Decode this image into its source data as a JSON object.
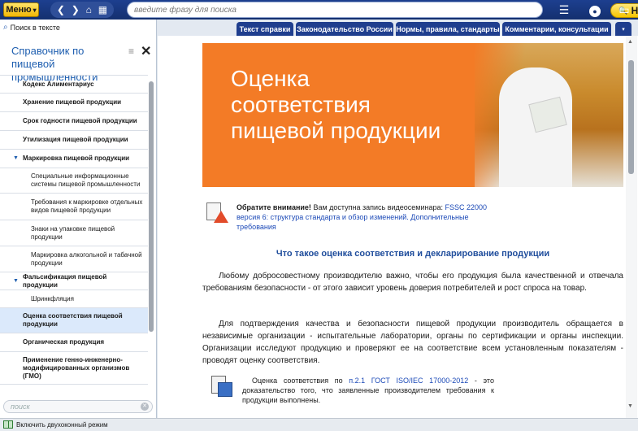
{
  "topbar": {
    "menu_label": "Меню",
    "menu_caret": "▾",
    "nav_back": "❮",
    "nav_forward": "❯",
    "nav_home": "⌂",
    "nav_grid": "▦",
    "search_placeholder": "введите фразу для поиска",
    "find_label": "Найти",
    "find_icon": "🔍",
    "hamburger_icon": "☰",
    "user_icon": "●",
    "chat_icon": "▭"
  },
  "sidebar": {
    "search_in_text": "Поиск в тексте",
    "title": "Справочник по пищевой промышленности",
    "menu_icon": "≡",
    "close_icon": "✕",
    "filter_placeholder": "поиск",
    "items": [
      {
        "label": "Кодекс Алиментариус",
        "level": 0,
        "h": 22
      },
      {
        "label": "Хранение пищевой продукции",
        "level": 0,
        "h": 23
      },
      {
        "label": "Срок годности пищевой продукции",
        "level": 0,
        "h": 23
      },
      {
        "label": "Утилизация пищевой продукции",
        "level": 0,
        "h": 23
      },
      {
        "label": "Маркировка пищевой продукции",
        "level": 0,
        "h": 23,
        "expanded": true
      },
      {
        "label": "Специальные информационные системы пищевой промышленности",
        "level": 1,
        "h": 31
      },
      {
        "label": "Требования к маркировке отдельных видов пищевой продукции",
        "level": 1,
        "h": 33
      },
      {
        "label": "Знаки на упаковке пищевой продукции",
        "level": 1,
        "h": 32
      },
      {
        "label": "Маркировка алкогольной и табачной продукции",
        "level": 1,
        "h": 32
      },
      {
        "label": "Фальсификация пищевой продукции",
        "level": 0,
        "h": 22,
        "expanded": true
      },
      {
        "label": "Шринкфляция",
        "level": 1,
        "h": 22
      },
      {
        "label": "Оценка соответствия пищевой продукции",
        "level": 0,
        "h": 31,
        "active": true
      },
      {
        "label": "Органическая продукция",
        "level": 0,
        "h": 23
      },
      {
        "label": "Применение генно-инженерно-модифицированных организмов (ГМО)",
        "level": 0,
        "h": 40
      }
    ]
  },
  "tabs": [
    {
      "label": "Текст справки",
      "active": true
    },
    {
      "label": "Законодательство России",
      "active": false
    },
    {
      "label": "Нормы, правила, стандарты",
      "active": false
    },
    {
      "label": "Комментарии, консультации",
      "active": false
    }
  ],
  "tab_more_icon": "▾",
  "document": {
    "banner_title": "Оценка соответствия пищевой продукции",
    "notice_bold": "Обратите внимание!",
    "notice_text": "Вам доступна запись видеосеминара:",
    "notice_link": "FSSC 22000 версия 6: структура стандарта и обзор изменений. Дополнительные требования",
    "heading": "Что такое оценка соответствия и декларирование продукции",
    "para1": "Любому добросовестному производителю важно, чтобы его продукция была качественной и отвечала требованиям безопасности - от этого зависит уровень доверия потребителей и рост спроса на товар.",
    "para2": "Для подтверждения качества и безопасности пищевой продукции производитель обращается в независимые организации - испытательные лаборатории, органы по сертификации и органы инспекции. Организации исследуют продукцию и проверяют ее на соответствие всем установленным показателям - проводят оценку соответствия.",
    "note_pre": "Оценка соответствия по",
    "note_link": "п.2.1 ГОСТ ISO/IEC 17000-2012",
    "note_post": "- это доказательство того, что заявленные производителем требования к продукции выполнены."
  },
  "statusbar": {
    "dual_mode": "Включить двухоконный режим"
  },
  "colors": {
    "topbar": "#14306f",
    "accent_yellow": "#f5c400",
    "link": "#1b49b7",
    "banner": "#f37b26",
    "heading": "#1f4d9c"
  }
}
